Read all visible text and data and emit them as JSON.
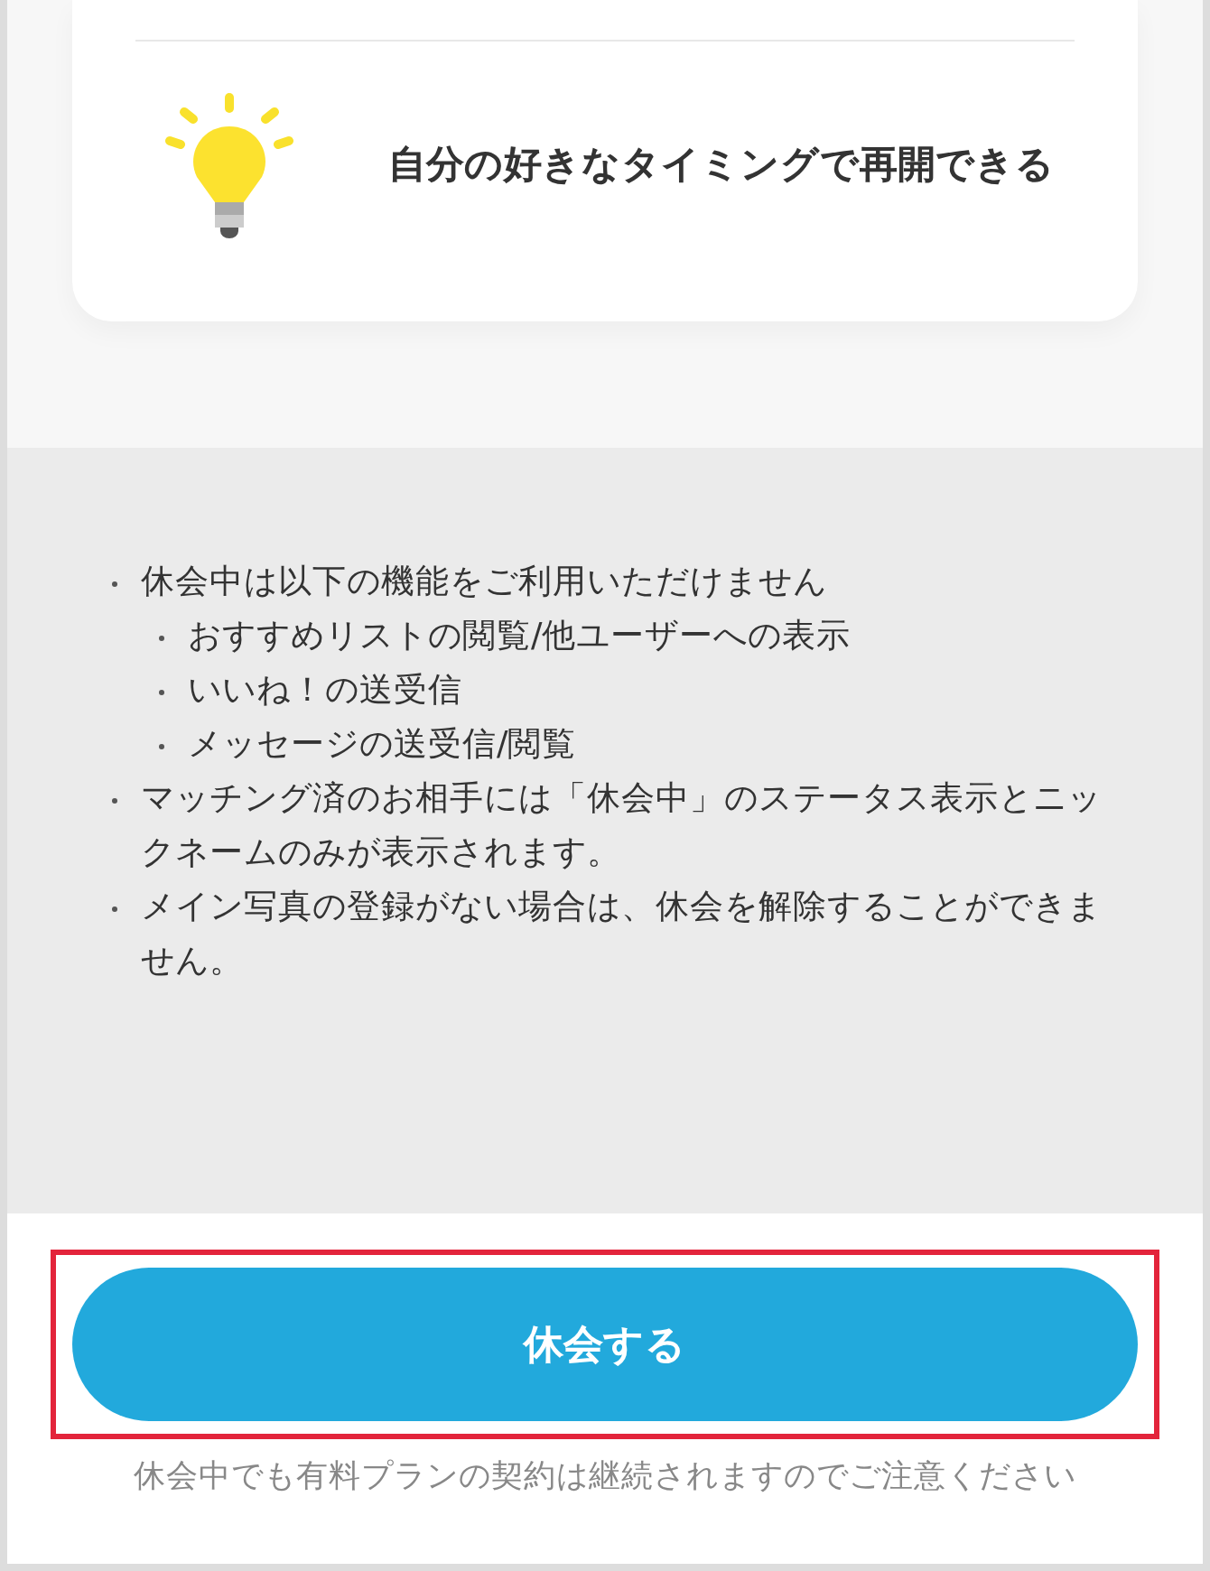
{
  "feature_card": {
    "text": "自分の好きなタイミングで再開できる"
  },
  "notes": [
    {
      "text": "休会中は以下の機能をご利用いただけません",
      "children": [
        {
          "text": "おすすめリストの閲覧/他ユーザーへの表示"
        },
        {
          "text": "いいね！の送受信"
        },
        {
          "text": "メッセージの送受信/閲覧"
        }
      ]
    },
    {
      "text": "マッチング済のお相手には「休会中」のステータス表示とニックネームのみが表示されます。"
    },
    {
      "text": "メイン写真の登録がない場合は、休会を解除することができません。"
    }
  ],
  "submit_button": {
    "label": "休会する",
    "highlighted": true
  },
  "caption": "休会中でも有料プランの契約は継続されますのでご注意ください"
}
